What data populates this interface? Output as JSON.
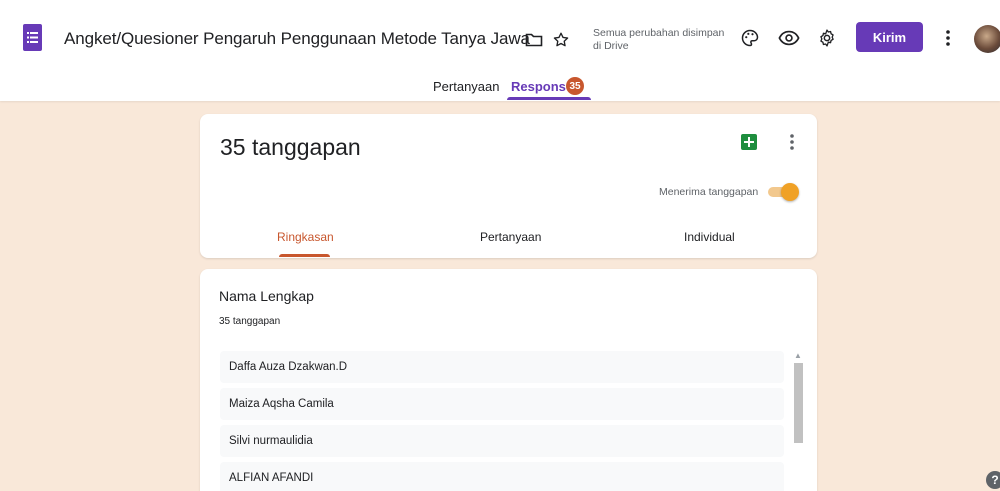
{
  "header": {
    "title": "Angket/Quesioner Pengaruh  Penggunaan Metode Tanya Jawab Terhadap Kreativitas Belajar Siswa",
    "saved_line1": "Semua perubahan disimpan",
    "saved_line2": "di Drive",
    "send_label": "Kirim"
  },
  "top_tabs": {
    "questions": "Pertanyaan",
    "responses": "Respons",
    "responses_badge": "35"
  },
  "summary": {
    "count_text": "35 tanggapan",
    "accepting_label": "Menerima tanggapan",
    "accepting": true,
    "tabs": [
      "Ringkasan",
      "Pertanyaan",
      "Individual"
    ],
    "active_tab": "Ringkasan"
  },
  "question": {
    "title": "Nama Lengkap",
    "count_text": "35 tanggapan",
    "answers": [
      "Daffa Auza Dzakwan.D",
      "Maiza Aqsha Camila",
      "Silvi nurmaulidia",
      "ALFIAN AFANDI"
    ]
  },
  "colors": {
    "brand": "#673ab7",
    "accent": "#c8572e",
    "background": "#f9e8d9",
    "toggle": "#f0a126",
    "sheets": "#1e8e3e"
  },
  "icons": [
    "forms-logo-icon",
    "folder-icon",
    "star-icon",
    "palette-icon",
    "eye-icon",
    "gear-icon",
    "more-vert-icon",
    "sheets-icon",
    "help-icon"
  ]
}
